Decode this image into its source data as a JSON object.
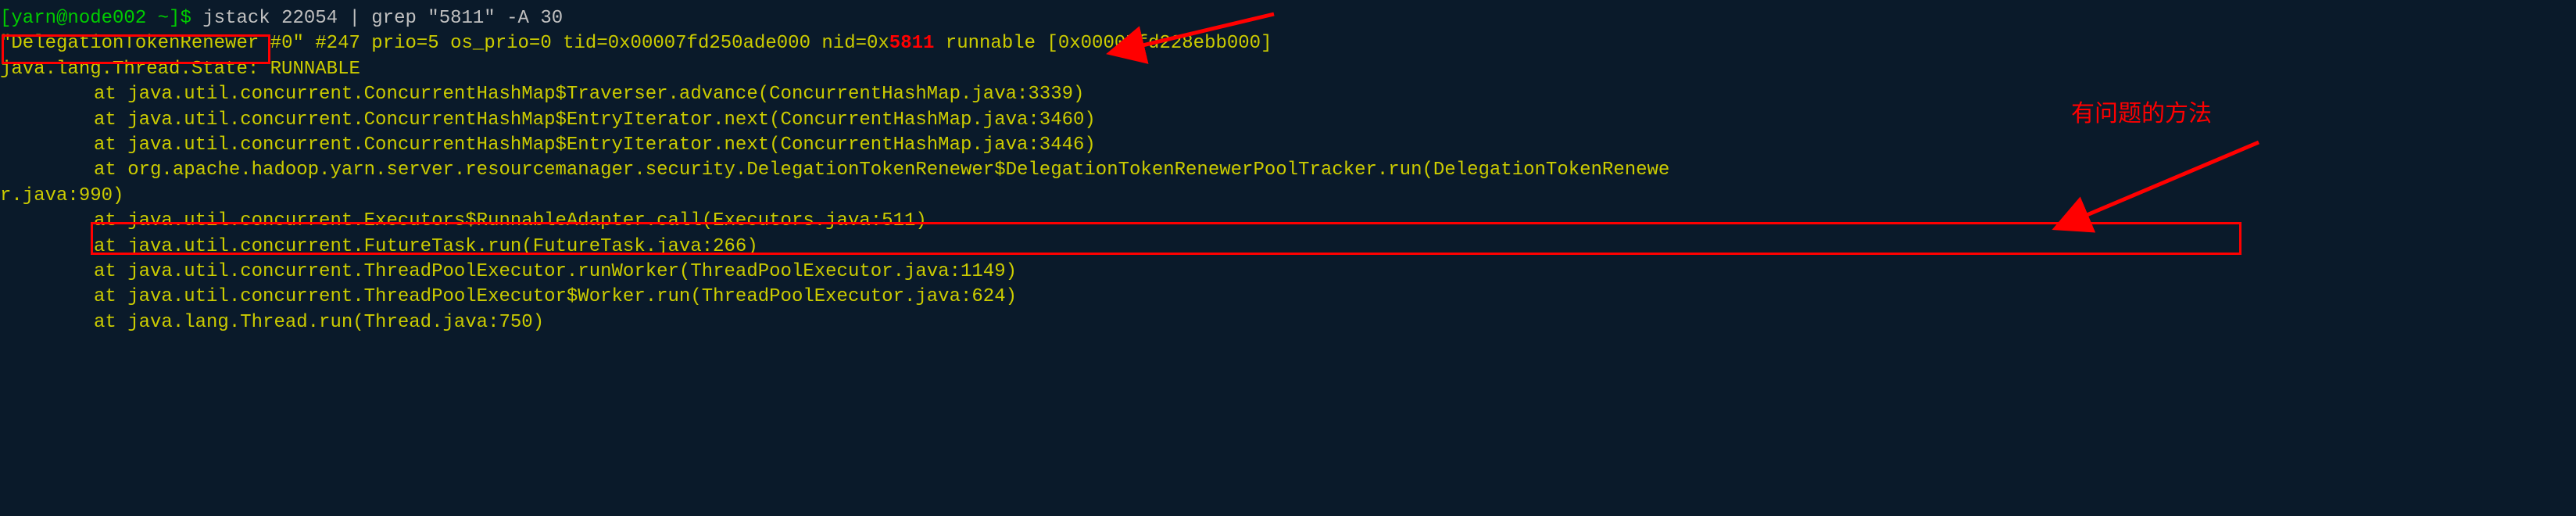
{
  "prompt": {
    "user_host": "[yarn@node002 ~]$",
    "command": " jstack 22054 | grep \"5811\" -A 30"
  },
  "thread_header": {
    "name": "\"DelegationTokenRenewer",
    "rest_pre": " #0\" #247 prio=5 os_prio=0 tid=0x00007fd250ade000 nid=0x",
    "nid": "5811",
    "rest_post": " runnable [0x00007fd228ebb000]"
  },
  "state_line": "   java.lang.Thread.State: RUNNABLE",
  "traces": [
    "at java.util.concurrent.ConcurrentHashMap$Traverser.advance(ConcurrentHashMap.java:3339)",
    "at java.util.concurrent.ConcurrentHashMap$EntryIterator.next(ConcurrentHashMap.java:3460)",
    "at java.util.concurrent.ConcurrentHashMap$EntryIterator.next(ConcurrentHashMap.java:3446)"
  ],
  "problem_trace_prefix": "at org.apache.hadoop.yarn.server.resourcemanager.security.DelegationTokenRenewer$DelegationTokenRenewerPoolTracker.run",
  "problem_trace_suffix": "(DelegationTokenRenewe",
  "problem_trace_cont": "r.java:990)",
  "traces2": [
    "at java.util.concurrent.Executors$RunnableAdapter.call(Executors.java:511)",
    "at java.util.concurrent.FutureTask.run(FutureTask.java:266)",
    "at java.util.concurrent.ThreadPoolExecutor.runWorker(ThreadPoolExecutor.java:1149)",
    "at java.util.concurrent.ThreadPoolExecutor$Worker.run(ThreadPoolExecutor.java:624)",
    "at java.lang.Thread.run(Thread.java:750)"
  ],
  "annotation_text": "有问题的方法"
}
